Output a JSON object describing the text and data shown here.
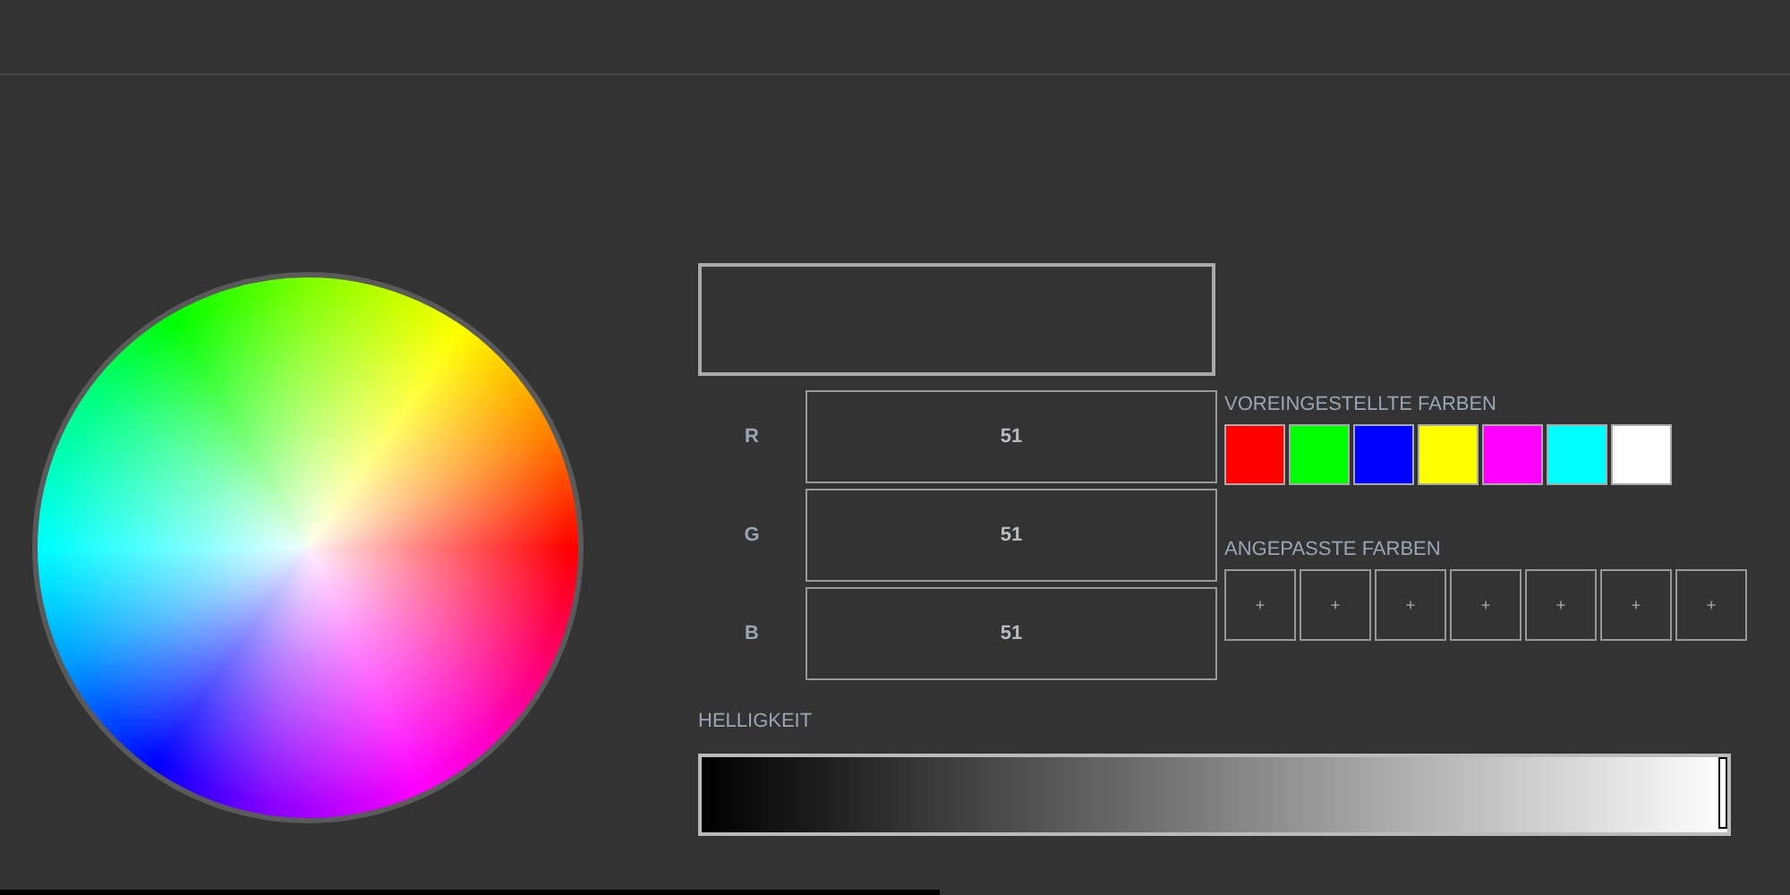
{
  "channels": [
    {
      "label": "R",
      "value": "51"
    },
    {
      "label": "G",
      "value": "51"
    },
    {
      "label": "B",
      "value": "51"
    }
  ],
  "presets": {
    "title": "VOREINGESTELLTE FARBEN",
    "swatches": [
      {
        "color": "#ff0000"
      },
      {
        "color": "#00ff00"
      },
      {
        "color": "#0000ff"
      },
      {
        "color": "#ffff00"
      },
      {
        "color": "#ff00ff"
      },
      {
        "color": "#00ffff"
      },
      {
        "color": "#ffffff"
      }
    ]
  },
  "custom": {
    "title": "ANGEPASSTE FARBEN",
    "slots": [
      "+",
      "+",
      "+",
      "+",
      "+",
      "+",
      "+"
    ]
  },
  "brightness": {
    "label": "HELLIGKEIT",
    "level": 1
  }
}
